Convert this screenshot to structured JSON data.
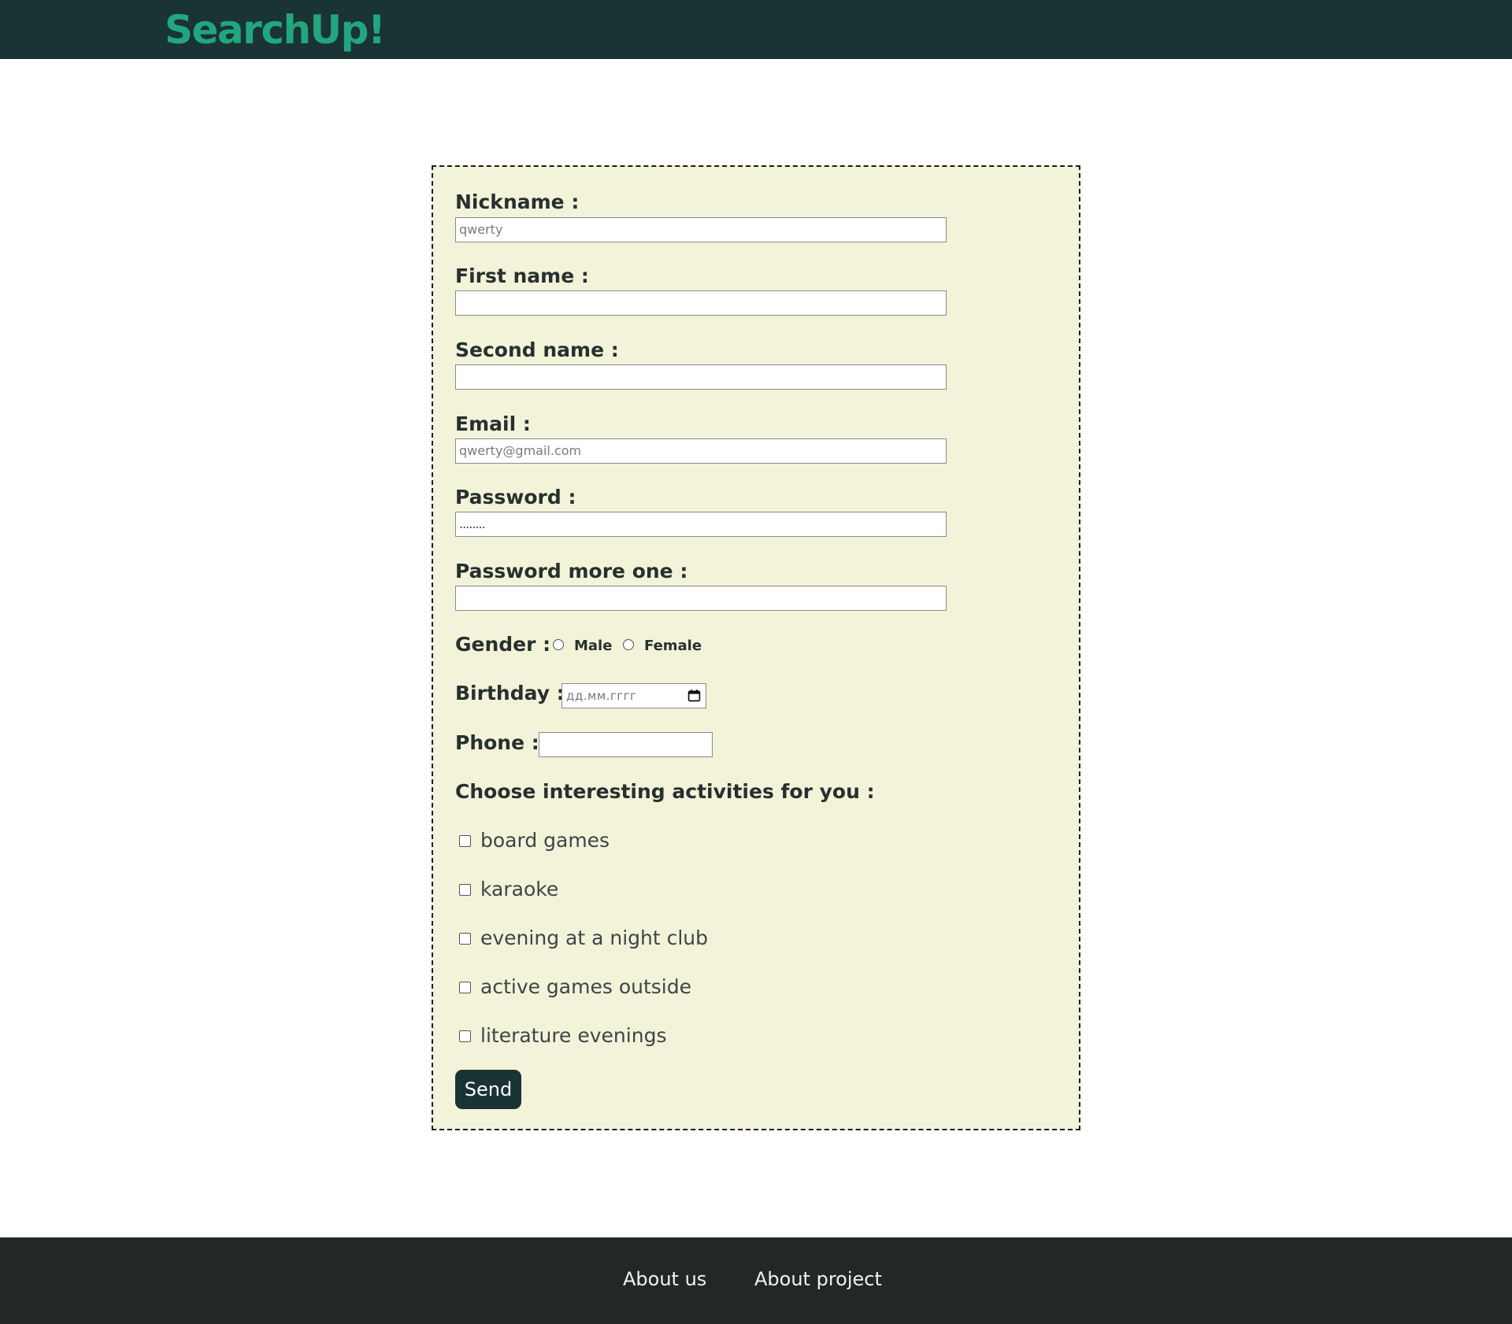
{
  "header": {
    "logo": "SearchUp!"
  },
  "form": {
    "nickname": {
      "label": "Nickname :",
      "placeholder": "qwerty"
    },
    "first_name": {
      "label": "First name :",
      "placeholder": ""
    },
    "second_name": {
      "label": "Second name :",
      "placeholder": ""
    },
    "email": {
      "label": "Email :",
      "placeholder": "qwerty@gmail.com"
    },
    "password": {
      "label": "Password :",
      "placeholder": "........"
    },
    "password_repeat": {
      "label": "Password more one :",
      "placeholder": ""
    },
    "gender": {
      "label": "Gender :",
      "options": [
        "Male",
        "Female"
      ]
    },
    "birthday": {
      "label": "Birthday :",
      "placeholder": "дд.мм.гггг",
      "icon": "calendar-icon"
    },
    "phone": {
      "label": "Phone :",
      "value": ""
    },
    "activities": {
      "label": "Choose interesting activities for you :",
      "options": [
        "board games",
        "karaoke",
        "evening at a night club",
        "active games outside",
        "literature evenings"
      ]
    },
    "send_label": "Send"
  },
  "footer": {
    "links": [
      "About us",
      "About project"
    ]
  }
}
